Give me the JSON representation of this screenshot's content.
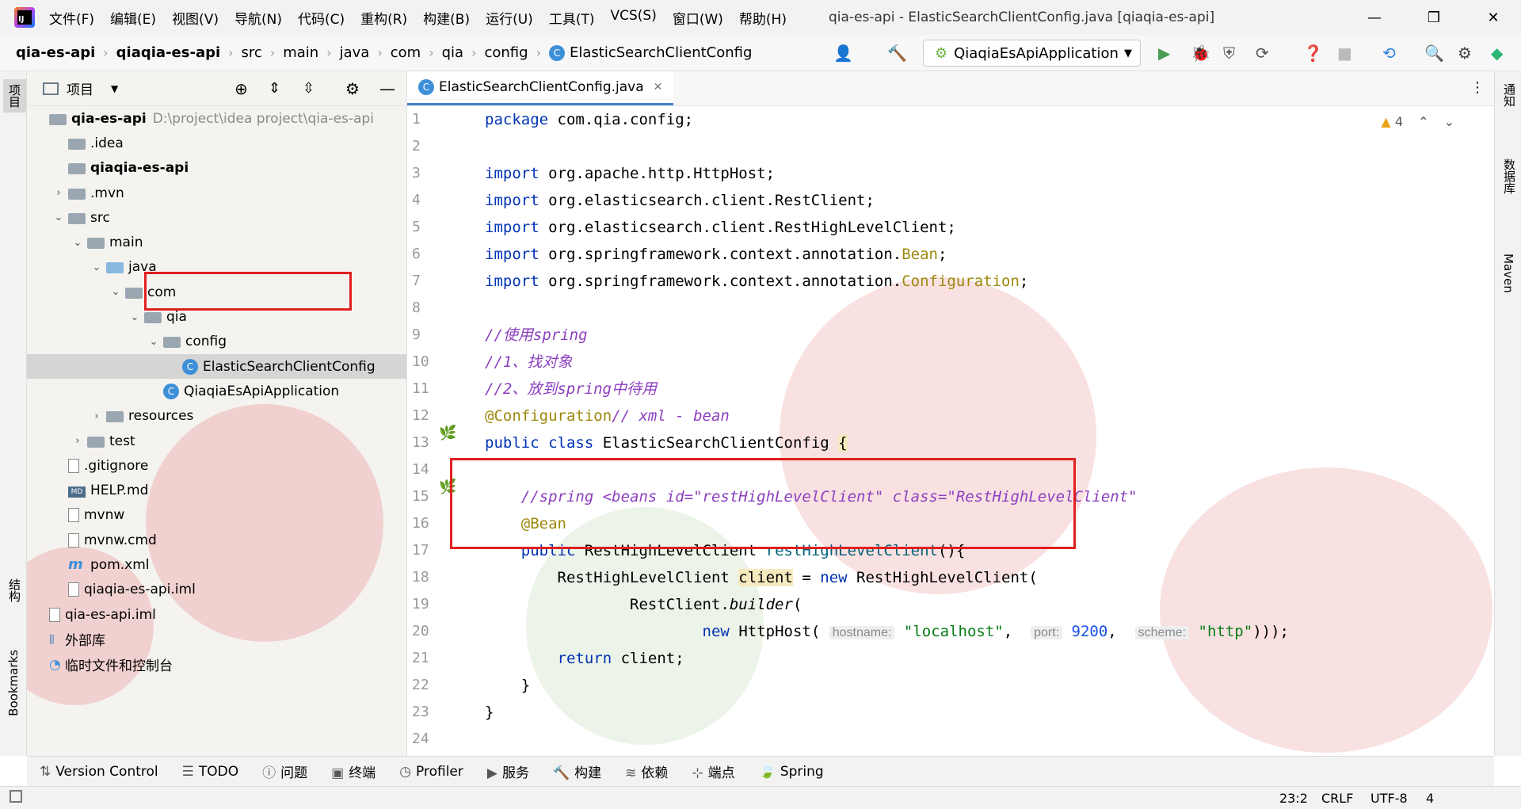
{
  "menu": [
    "文件(F)",
    "编辑(E)",
    "视图(V)",
    "导航(N)",
    "代码(C)",
    "重构(R)",
    "构建(B)",
    "运行(U)",
    "工具(T)",
    "VCS(S)",
    "窗口(W)",
    "帮助(H)"
  ],
  "window_title": "qia-es-api - ElasticSearchClientConfig.java [qiaqia-es-api]",
  "breadcrumb": [
    "qia-es-api",
    "qiaqia-es-api",
    "src",
    "main",
    "java",
    "com",
    "qia",
    "config",
    "ElasticSearchClientConfig"
  ],
  "run_config": "QiaqiaEsApiApplication",
  "left_strip": {
    "project": "项目",
    "structure": "结构",
    "bookmarks": "Bookmarks"
  },
  "right_strip": {
    "notifications": "通知",
    "database": "数据库",
    "maven": "Maven"
  },
  "project_panel": {
    "title": "项目"
  },
  "tree": [
    {
      "label": "qia-es-api",
      "extra": "D:\\project\\idea project\\qia-es-api",
      "depth": 0,
      "arrow": "",
      "icon": "folder",
      "bold": true
    },
    {
      "label": ".idea",
      "depth": 1,
      "arrow": "",
      "icon": "folder"
    },
    {
      "label": "qiaqia-es-api",
      "depth": 1,
      "arrow": "",
      "icon": "folder",
      "bold": true
    },
    {
      "label": ".mvn",
      "depth": 1,
      "arrow": "›",
      "icon": "folder"
    },
    {
      "label": "src",
      "depth": 1,
      "arrow": "⌄",
      "icon": "folder"
    },
    {
      "label": "main",
      "depth": 2,
      "arrow": "⌄",
      "icon": "folder"
    },
    {
      "label": "java",
      "depth": 3,
      "arrow": "⌄",
      "icon": "folder-blue"
    },
    {
      "label": "com",
      "depth": 4,
      "arrow": "⌄",
      "icon": "package"
    },
    {
      "label": "qia",
      "depth": 5,
      "arrow": "⌄",
      "icon": "package"
    },
    {
      "label": "config",
      "depth": 6,
      "arrow": "⌄",
      "icon": "package"
    },
    {
      "label": "ElasticSearchClientConfig",
      "depth": 7,
      "arrow": "",
      "icon": "class",
      "selected": true
    },
    {
      "label": "QiaqiaEsApiApplication",
      "depth": 6,
      "arrow": "",
      "icon": "class"
    },
    {
      "label": "resources",
      "depth": 3,
      "arrow": "›",
      "icon": "folder"
    },
    {
      "label": "test",
      "depth": 2,
      "arrow": "›",
      "icon": "folder"
    },
    {
      "label": ".gitignore",
      "depth": 1,
      "arrow": "",
      "icon": "file"
    },
    {
      "label": "HELP.md",
      "depth": 1,
      "arrow": "",
      "icon": "md"
    },
    {
      "label": "mvnw",
      "depth": 1,
      "arrow": "",
      "icon": "file"
    },
    {
      "label": "mvnw.cmd",
      "depth": 1,
      "arrow": "",
      "icon": "file"
    },
    {
      "label": "pom.xml",
      "depth": 1,
      "arrow": "",
      "icon": "maven"
    },
    {
      "label": "qiaqia-es-api.iml",
      "depth": 1,
      "arrow": "",
      "icon": "file"
    },
    {
      "label": "qia-es-api.iml",
      "depth": 0,
      "arrow": "",
      "icon": "file"
    },
    {
      "label": "外部库",
      "depth": 0,
      "arrow": "",
      "icon": "lib"
    },
    {
      "label": "临时文件和控制台",
      "depth": 0,
      "arrow": "",
      "icon": "scratch"
    }
  ],
  "editor": {
    "tab": "ElasticSearchClientConfig.java",
    "warnings": "4",
    "line_numbers": [
      "1",
      "2",
      "3",
      "4",
      "5",
      "6",
      "7",
      "8",
      "9",
      "10",
      "11",
      "12",
      "13",
      "14",
      "15",
      "16",
      "17",
      "18",
      "19",
      "20",
      "21",
      "22",
      "23",
      "24"
    ]
  },
  "code": [
    [
      {
        "t": "package",
        "c": "kw"
      },
      {
        "t": " com.qia.config;"
      }
    ],
    [],
    [
      {
        "t": "import",
        "c": "kw"
      },
      {
        "t": " org.apache.http.HttpHost;"
      }
    ],
    [
      {
        "t": "import",
        "c": "kw"
      },
      {
        "t": " org.elasticsearch.client.RestClient;"
      }
    ],
    [
      {
        "t": "import",
        "c": "kw"
      },
      {
        "t": " org.elasticsearch.client.RestHighLevelClient;"
      }
    ],
    [
      {
        "t": "import",
        "c": "kw"
      },
      {
        "t": " org.springframework.context.annotation."
      },
      {
        "t": "Bean",
        "c": "an"
      },
      {
        "t": ";"
      }
    ],
    [
      {
        "t": "import",
        "c": "kw"
      },
      {
        "t": " org.springframework.context.annotation."
      },
      {
        "t": "Configuration",
        "c": "an"
      },
      {
        "t": ";"
      }
    ],
    [],
    [
      {
        "t": "//使用spring",
        "c": "cm"
      }
    ],
    [
      {
        "t": "//1、找对象",
        "c": "cm"
      }
    ],
    [
      {
        "t": "//2、放到spring中待用",
        "c": "cm"
      }
    ],
    [
      {
        "t": "@Configuration",
        "c": "an"
      },
      {
        "t": "// xml - bean",
        "c": "cm"
      }
    ],
    [
      {
        "t": "public class",
        "c": "kw"
      },
      {
        "t": " ElasticSearchClientConfig "
      },
      {
        "t": "{",
        "c": "hl"
      }
    ],
    [],
    [
      {
        "t": "    "
      },
      {
        "t": "//spring <beans id=\"restHighLevelClient\" class=\"RestHighLevelClient\"",
        "c": "cm"
      }
    ],
    [
      {
        "t": "    "
      },
      {
        "t": "@Bean",
        "c": "an"
      }
    ],
    [
      {
        "t": "    "
      },
      {
        "t": "public",
        "c": "kw"
      },
      {
        "t": " RestHighLevelClient "
      },
      {
        "t": "restHighLevelClient",
        "c": "fn"
      },
      {
        "t": "(){"
      }
    ],
    [
      {
        "t": "        RestHighLevelClient "
      },
      {
        "t": "client",
        "c": "hl"
      },
      {
        "t": " = "
      },
      {
        "t": "new",
        "c": "kw"
      },
      {
        "t": " RestHighLevelClient("
      }
    ],
    [
      {
        "t": "                RestClient."
      },
      {
        "t": "builder",
        "c": "it"
      },
      {
        "t": "("
      }
    ],
    [
      {
        "t": "                        "
      },
      {
        "t": "new",
        "c": "kw"
      },
      {
        "t": " HttpHost( "
      },
      {
        "t": "hostname:",
        "c": "hint"
      },
      {
        "t": " "
      },
      {
        "t": "\"localhost\"",
        "c": "str"
      },
      {
        "t": ",  "
      },
      {
        "t": "port:",
        "c": "hint"
      },
      {
        "t": " "
      },
      {
        "t": "9200",
        "c": "num"
      },
      {
        "t": ",  "
      },
      {
        "t": "scheme:",
        "c": "hint"
      },
      {
        "t": " "
      },
      {
        "t": "\"http\"",
        "c": "str"
      },
      {
        "t": ")));"
      }
    ],
    [
      {
        "t": "        "
      },
      {
        "t": "return",
        "c": "kw"
      },
      {
        "t": " client;"
      }
    ],
    [
      {
        "t": "    }"
      }
    ],
    [
      {
        "t": "}"
      }
    ],
    []
  ],
  "bottom_tools": [
    "Version Control",
    "TODO",
    "问题",
    "终端",
    "Profiler",
    "服务",
    "构建",
    "依赖",
    "端点",
    "Spring"
  ],
  "status": {
    "position": "23:2",
    "line_sep": "CRLF",
    "encoding": "UTF-8",
    "indent": "4"
  }
}
